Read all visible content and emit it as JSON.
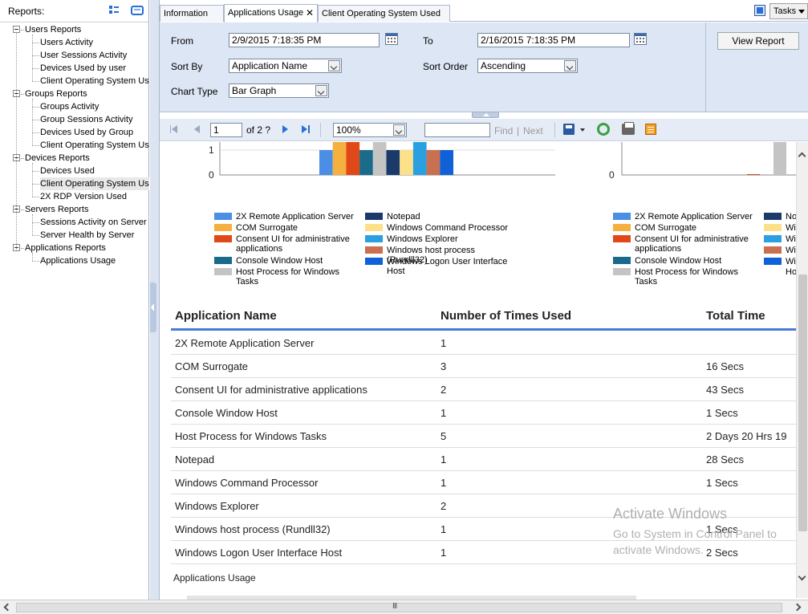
{
  "left_panel": {
    "title": "Reports:",
    "tree": [
      {
        "label": "Users Reports",
        "children": [
          "Users Activity",
          "User Sessions Activity",
          "Devices Used by user",
          "Client Operating System Usage"
        ]
      },
      {
        "label": "Groups Reports",
        "children": [
          "Groups Activity",
          "Group Sessions Activity",
          "Devices Used by Group",
          "Client Operating System Usage"
        ]
      },
      {
        "label": "Devices Reports",
        "children": [
          "Devices Used",
          "Client Operating System Usage",
          "2X RDP Version Used"
        ]
      },
      {
        "label": "Servers Reports",
        "children": [
          "Sessions Activity on Server",
          "Server Health by Server"
        ]
      },
      {
        "label": "Applications Reports",
        "children": [
          "Applications Usage"
        ]
      }
    ],
    "selected": "Client Operating System Usage"
  },
  "tabs": [
    {
      "label": "Information"
    },
    {
      "label": "Applications Usage",
      "active": true
    },
    {
      "label": "Client Operating System Used"
    }
  ],
  "tab_close": "✕",
  "tasks_label": "Tasks",
  "params": {
    "from_label": "From",
    "from_value": "2/9/2015 7:18:35 PM",
    "to_label": "To",
    "to_value": "2/16/2015 7:18:35 PM",
    "sort_by_label": "Sort By",
    "sort_by_value": "Application Name",
    "sort_order_label": "Sort Order",
    "sort_order_value": "Ascending",
    "chart_type_label": "Chart Type",
    "chart_type_value": "Bar Graph",
    "view_report_label": "View Report"
  },
  "toolbar": {
    "page_value": "1",
    "page_of": "of 2 ?",
    "zoom_value": "100%",
    "find_label": "Find",
    "separator": "|",
    "next_label": "Next"
  },
  "chart_data": [
    {
      "type": "bar",
      "yticks": [
        "1",
        "0"
      ],
      "bar_colors": [
        "#4a8ee6",
        "#f5b040",
        "#e04818",
        "#1a6a8a",
        "#c4c4c4",
        "#1a3a6a",
        "#fce08a",
        "#2aa0e0",
        "#c87050",
        "#1060d8"
      ],
      "values": [
        1,
        3,
        2,
        1,
        5,
        1,
        1,
        2,
        1,
        1
      ],
      "ylim": [
        0,
        1.2
      ]
    },
    {
      "type": "bar",
      "yticks": [
        "0"
      ],
      "bar_colors": [
        "#c84818",
        "#c4c4c4"
      ],
      "values": [
        0.5,
        5
      ],
      "ylim": [
        0,
        1.2
      ]
    }
  ],
  "legend": [
    {
      "label": "2X Remote Application Server",
      "color": "#4a8ee6"
    },
    {
      "label": "COM Surrogate",
      "color": "#f5b040"
    },
    {
      "label": "Consent UI for administrative applications",
      "color": "#e04818"
    },
    {
      "label": "Console Window Host",
      "color": "#1a6a8a"
    },
    {
      "label": "Host Process for Windows Tasks",
      "color": "#c4c4c4"
    },
    {
      "label": "Notepad",
      "color": "#1a3a6a"
    },
    {
      "label": "Windows Command Processor",
      "color": "#fce08a"
    },
    {
      "label": "Windows Explorer",
      "color": "#2aa0e0"
    },
    {
      "label": "Windows host process (Rundll32)",
      "color": "#c87050"
    },
    {
      "label": "Windows Logon User Interface Host",
      "color": "#1060d8"
    }
  ],
  "legend2_col2_clip": [
    "No",
    "Wi",
    "Wi",
    "Wi",
    "Wi",
    "Ho"
  ],
  "table": {
    "headers": [
      "Application Name",
      "Number of Times Used",
      "Total Time"
    ],
    "rows": [
      [
        "2X Remote Application Server",
        "1",
        ""
      ],
      [
        "COM Surrogate",
        "3",
        "16 Secs"
      ],
      [
        "Consent UI for administrative applications",
        "2",
        "43 Secs"
      ],
      [
        "Console Window Host",
        "1",
        "1 Secs"
      ],
      [
        "Host Process for Windows Tasks",
        "5",
        "2 Days 20 Hrs 19"
      ],
      [
        "Notepad",
        "1",
        "28 Secs"
      ],
      [
        "Windows Command Processor",
        "1",
        "1 Secs"
      ],
      [
        "Windows Explorer",
        "2",
        ""
      ],
      [
        "Windows host process (Rundll32)",
        "1",
        "1 Secs"
      ],
      [
        "Windows Logon User Interface Host",
        "1",
        "2 Secs"
      ]
    ]
  },
  "footer_label": "Applications Usage",
  "watermark": {
    "title": "Activate Windows",
    "line1": "Go to System in Control Panel to",
    "line2": "activate Windows."
  }
}
